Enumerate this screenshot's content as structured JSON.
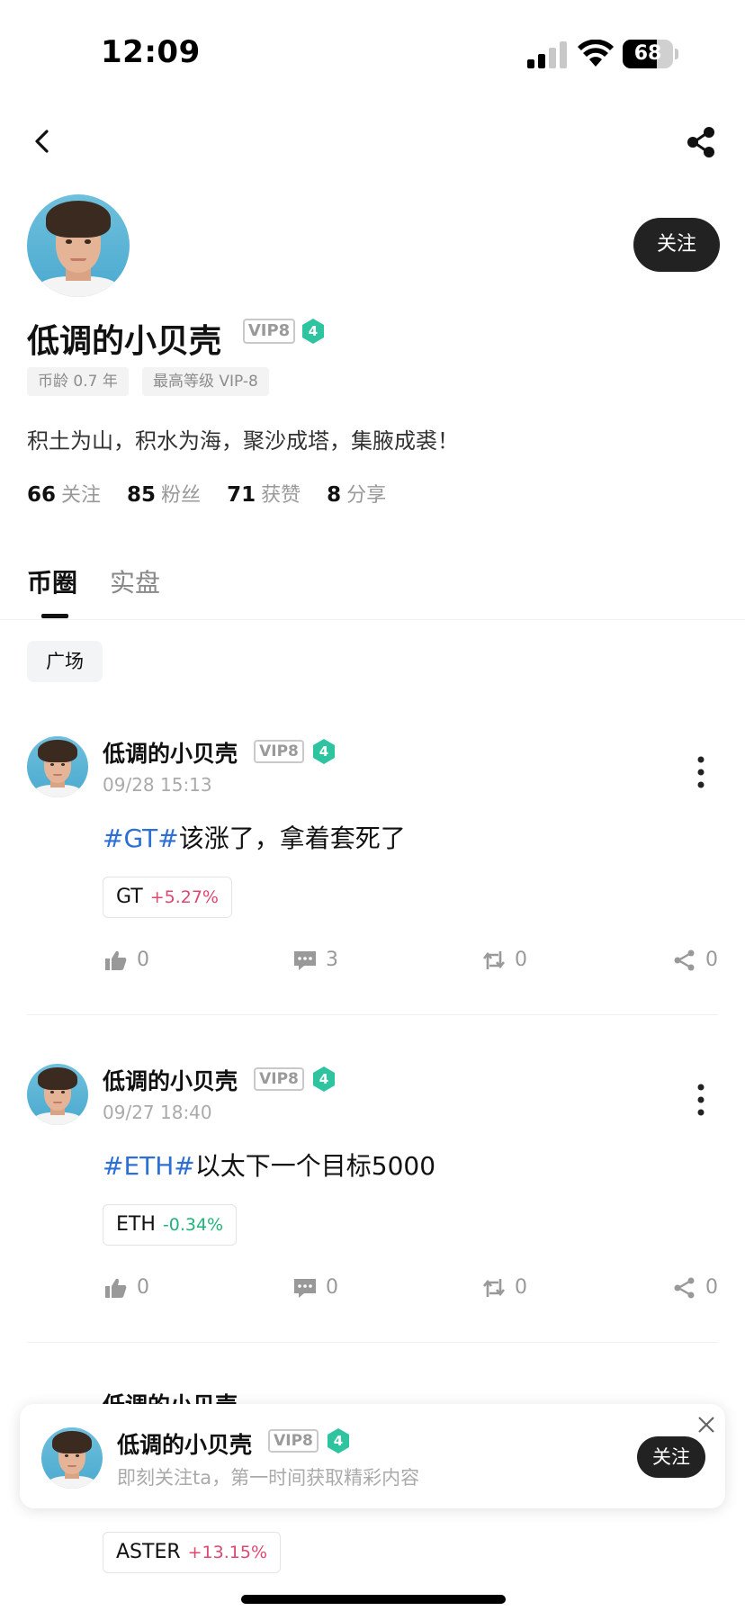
{
  "status_bar": {
    "time": "12:09",
    "battery": "68",
    "battery_level": 0.68
  },
  "profile": {
    "name": "低调的小贝壳",
    "vip": "VIP8",
    "badge_level": "4",
    "tags": [
      "币龄 0.7 年",
      "最高等级 VIP-8"
    ],
    "bio": "积土为山，积水为海，聚沙成塔，集腋成裘！",
    "follow_label": "关注",
    "stats": [
      {
        "value": "66",
        "label": "关注"
      },
      {
        "value": "85",
        "label": "粉丝"
      },
      {
        "value": "71",
        "label": "获赞"
      },
      {
        "value": "8",
        "label": "分享"
      }
    ]
  },
  "tabs": [
    {
      "label": "币圈",
      "active": true
    },
    {
      "label": "实盘",
      "active": false
    }
  ],
  "filter": {
    "label": "广场"
  },
  "posts": [
    {
      "author": "低调的小贝壳",
      "vip": "VIP8",
      "badge": "4",
      "time": "09/28 15:13",
      "hashtag": "#GT#",
      "text": "该涨了，拿着套死了",
      "coin": {
        "name": "GT",
        "change": "+5.27%",
        "direction": "up"
      },
      "likes": "0",
      "comments": "3",
      "reposts": "0",
      "shares": "0"
    },
    {
      "author": "低调的小贝壳",
      "vip": "VIP8",
      "badge": "4",
      "time": "09/27 18:40",
      "hashtag": "#ETH#",
      "text": "以太下一个目标5000",
      "coin": {
        "name": "ETH",
        "change": "-0.34%",
        "direction": "down"
      },
      "likes": "0",
      "comments": "0",
      "reposts": "0",
      "shares": "0"
    }
  ],
  "partial_post": {
    "author": "低调的小贝壳",
    "coin": {
      "name": "ASTER",
      "change": "+13.15%",
      "direction": "up"
    }
  },
  "banner": {
    "name": "低调的小贝壳",
    "vip": "VIP8",
    "badge": "4",
    "subtitle": "即刻关注ta，第一时间获取精彩内容",
    "follow_label": "关注"
  },
  "colors": {
    "hashtag": "#2c6fd6",
    "up": "#e0476f",
    "down": "#20b47a",
    "badge": "#2fc4a0",
    "button_dark": "#222222"
  }
}
